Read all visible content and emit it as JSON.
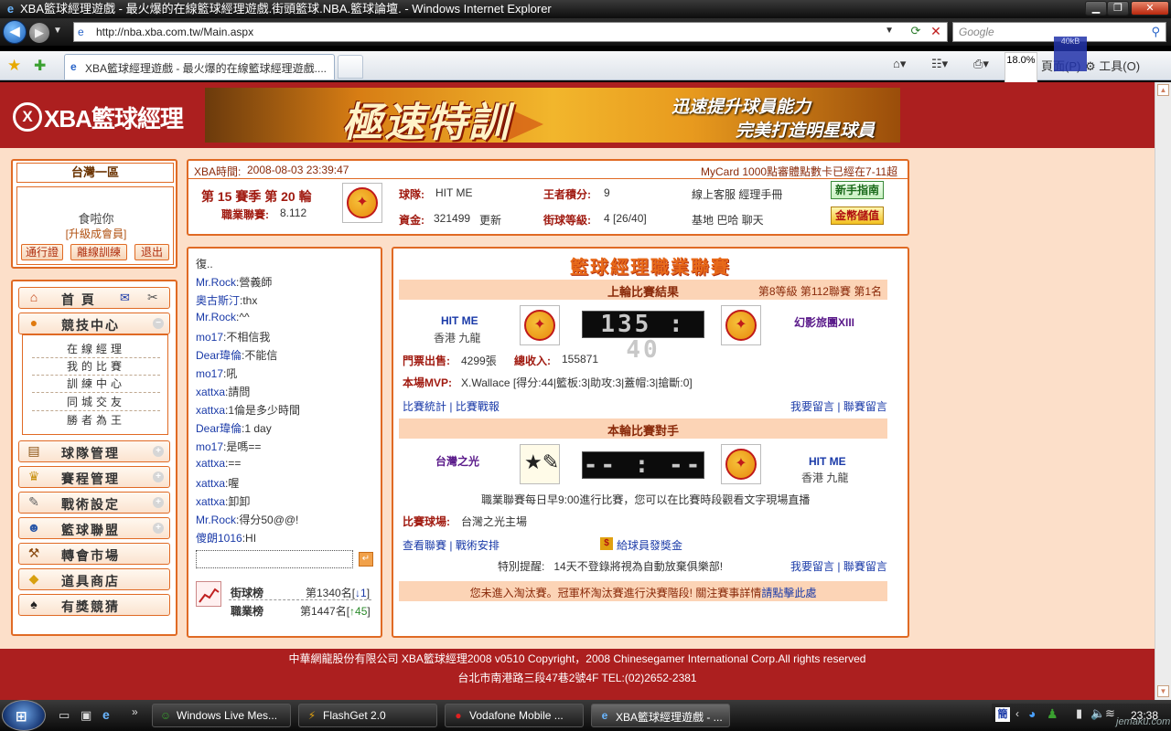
{
  "window": {
    "title": "XBA籃球經理遊戲 - 最火爆的在線籃球經理遊戲.街頭籃球.NBA.籃球論壇. - Windows Internet Explorer",
    "min_label": "▁",
    "max_label": "❐",
    "close_label": "✕"
  },
  "nav": {
    "url": "http://nba.xba.com.tw/Main.aspx",
    "search_placeholder": "Google"
  },
  "tab": {
    "title": "XBA籃球經理遊戲 - 最火爆的在線籃球經理遊戲...."
  },
  "commands": {
    "page_label": "頁面(P)",
    "tools_label": "工具(O)"
  },
  "overlay": {
    "zoom": "18.0%",
    "net": "40kB"
  },
  "site": {
    "logo_mark": "X",
    "logo_text": "XBA籃球經理",
    "banner": {
      "big": "極速特訓",
      "line1": "迅速提升球員能力",
      "line2": "完美打造明星球員"
    }
  },
  "left": {
    "area": "台灣一區",
    "username": "食啦你",
    "level": "[升級成會員]",
    "buttons": [
      "通行證",
      "離線訓練",
      "退出"
    ],
    "menu": [
      {
        "label": "首 頁",
        "icon": "home-icon"
      },
      {
        "label": "競技中心",
        "icon": "basketball-icon"
      },
      {
        "label": "球隊管理",
        "icon": "team-icon"
      },
      {
        "label": "賽程管理",
        "icon": "trophy-icon"
      },
      {
        "label": "戰術設定",
        "icon": "tactics-icon"
      },
      {
        "label": "籃球聯盟",
        "icon": "league-icon"
      },
      {
        "label": "轉會市場",
        "icon": "hammer-icon"
      },
      {
        "label": "道具商店",
        "icon": "gold-icon"
      },
      {
        "label": "有獎競猜",
        "icon": "spade-icon"
      }
    ],
    "submenu": [
      "在線經理",
      "我的比賽",
      "訓練中心",
      "同城交友",
      "勝者為王"
    ]
  },
  "info": {
    "time_label": "XBA時間:",
    "time": "2008-08-03 23:39:47",
    "marquee": "MyCard 1000點審體點數卡已經在7-11超",
    "season": "第 15 賽季 第 20 輪",
    "league_label": "職業聯賽:",
    "league_val": "8.112",
    "team_label": "球隊:",
    "team_val": "HIT ME",
    "points_label": "王者積分:",
    "points_val": "9",
    "links1": "線上客服 經理手冊",
    "funds_label": "資金:",
    "funds_val": "321499",
    "update": "更新",
    "street_label": "街球等級:",
    "street_val": "4 [26/40]",
    "links2": "基地 巴哈 聊天",
    "btn_guide": "新手指南",
    "btn_topup": "金幣儲值"
  },
  "chat": {
    "lines": [
      {
        "name": "",
        "msg": "復.."
      },
      {
        "name": "Mr.Rock",
        "msg": ":營義師"
      },
      {
        "name": "奧古斯汀",
        "msg": ":thx"
      },
      {
        "name": "Mr.Rock",
        "msg": ":^^"
      },
      {
        "name": "mo17",
        "msg": ":不相信我"
      },
      {
        "name": "Dear瑋倫",
        "msg": ":不能信"
      },
      {
        "name": "mo17",
        "msg": ":吼"
      },
      {
        "name": "xattxa",
        "msg": ":請問"
      },
      {
        "name": "xattxa",
        "msg": ":1倫是多少時間"
      },
      {
        "name": "Dear瑋倫",
        "msg": ":1 day"
      },
      {
        "name": "mo17",
        "msg": ":是嗎=="
      },
      {
        "name": "xattxa",
        "msg": ":=="
      },
      {
        "name": "xattxa",
        "msg": ":喔"
      },
      {
        "name": "xattxa",
        "msg": ":卸卸"
      },
      {
        "name": "Mr.Rock",
        "msg": ":得分50@@!"
      },
      {
        "name": "傻朗1016",
        "msg": ":HI"
      }
    ],
    "send": "↵",
    "rank1_label": "街球榜",
    "rank1_val": "第1340名[",
    "rank1_delta": "↓1",
    "rank2_label": "職業榜",
    "rank2_val": "第1447名[",
    "rank2_delta": "↑45"
  },
  "league": {
    "title": "籃球經理職業聯賽",
    "last_title": "上輪比賽結果",
    "last_meta": "第8等級 第112聯賽 第1名",
    "home": "HIT ME",
    "home_loc": "香港 九龍",
    "score": "135 : 40",
    "away": "幻影旅團XIII",
    "ticket_label": "門票出售:",
    "ticket_val": "4299張",
    "income_label": "總收入:",
    "income_val": "155871",
    "mvp_label": "本場MVP:",
    "mvp_val": "X.Wallace [得分:44|籃板:3|助攻:3|蓋帽:3|搶斷:0]",
    "link_stats": "比賽統計",
    "link_report": "比賽戰報",
    "link_msg1": "我要留言",
    "link_msg2": "聯賽留言",
    "next_title": "本輪比賽對手",
    "opp": "台灣之光",
    "next_score": "-- : --",
    "me": "HIT ME",
    "me_loc": "香港 九龍",
    "note": "職業聯賽每日早9:00進行比賽，您可以在比賽時段觀看文字現場直播",
    "venue_label": "比賽球場:",
    "venue_val": "台灣之光主場",
    "link_view": "查看聯賽",
    "link_tactic": "戰術安排",
    "bonus": "給球員發獎金",
    "warn_label": "特別提醒:",
    "warn_val": "14天不登錄將視為自動放棄俱樂部!",
    "cup": "您未進入淘汰賽。冠軍杯淘汰賽進行決賽階段! 關注賽事詳情",
    "cup_link": "請點擊此處"
  },
  "footer": {
    "line1": "中華網龍股份有限公司 XBA籃球經理2008 v0510 Copyright，2008 Chinesegamer International Corp.All rights reserved",
    "line2": "台北市南港路三段47巷2號4F TEL:(02)2652-2381"
  },
  "taskbar": {
    "items": [
      "Windows Live Mes...",
      "FlashGet 2.0",
      "Vodafone Mobile ...",
      "XBA籃球經理遊戲 - ..."
    ],
    "clock": "23:38",
    "watermark": "jemaku.com"
  }
}
